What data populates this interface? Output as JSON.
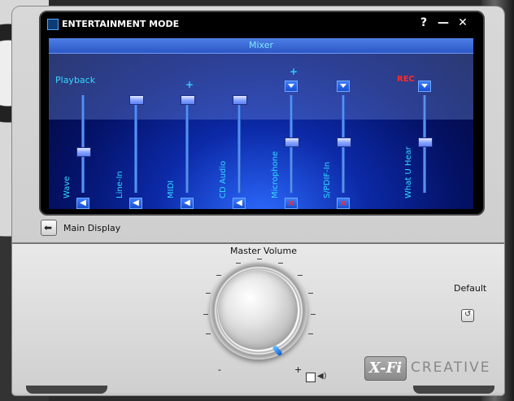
{
  "window": {
    "title": "ENTERTAINMENT MODE",
    "help_label": "?",
    "minimize_label": "—",
    "close_label": "✕"
  },
  "mixer": {
    "header": "Mixer",
    "playback_label": "Playback",
    "rec_label": "REC",
    "plus_mark": "+",
    "channels": [
      {
        "name": "Wave",
        "level": 0.45,
        "muted": false,
        "has_dropdown": false
      },
      {
        "name": "Line-In",
        "level": 0.95,
        "muted": false,
        "has_dropdown": false
      },
      {
        "name": "MIDI",
        "level": 0.95,
        "muted": false,
        "has_dropdown": false
      },
      {
        "name": "CD Audio",
        "level": 0.95,
        "muted": false,
        "has_dropdown": false
      },
      {
        "name": "Microphone",
        "level": 0.55,
        "muted": true,
        "has_dropdown": true
      },
      {
        "name": "S/PDIF-In",
        "level": 0.55,
        "muted": true,
        "has_dropdown": true
      },
      {
        "name": "What U Hear",
        "level": 0.55,
        "muted": false,
        "has_dropdown": true
      }
    ]
  },
  "navigation": {
    "main_display_label": "Main Display"
  },
  "master": {
    "label": "Master Volume",
    "minus_label": "-",
    "plus_label": "+",
    "speaker_icon": "speaker-icon"
  },
  "default": {
    "label": "Default"
  },
  "branding": {
    "xfi": "X-Fi",
    "creative": "CREATIVE"
  }
}
